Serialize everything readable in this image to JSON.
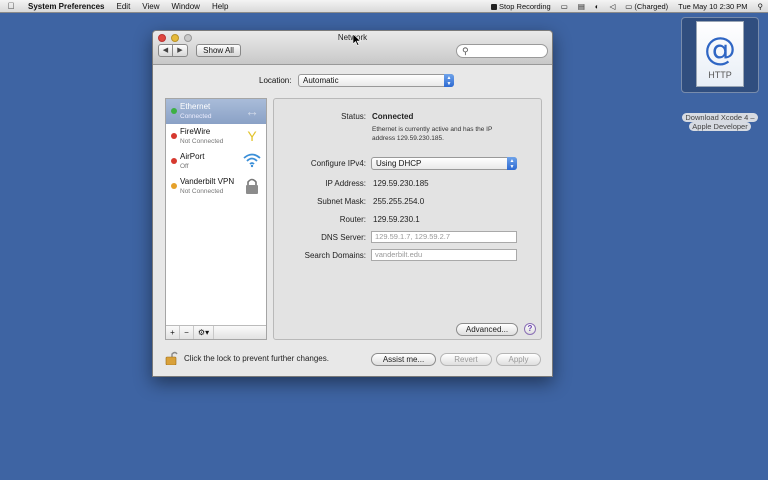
{
  "menubar": {
    "app_name": "System Preferences",
    "items": [
      "Edit",
      "View",
      "Window",
      "Help"
    ],
    "status": {
      "recording": "Stop Recording",
      "battery": "(Charged)",
      "clock": "Tue May 10  2:30 PM"
    }
  },
  "desktop_icon": {
    "glyph": "@",
    "type": "HTTP",
    "label_line1": "Download Xcode 4 –",
    "label_line2": "Apple Developer"
  },
  "window": {
    "title": "Network",
    "show_all": "Show All",
    "nav_back": "◀",
    "nav_forward": "▶",
    "search_placeholder": "",
    "location_label": "Location:",
    "location_value": "Automatic",
    "services": [
      {
        "name": "Ethernet",
        "status": "Connected",
        "dot": "#3cb043"
      },
      {
        "name": "FireWire",
        "status": "Not Connected",
        "dot": "#d6392f"
      },
      {
        "name": "AirPort",
        "status": "Off",
        "dot": "#d6392f"
      },
      {
        "name": "Vanderbilt VPN",
        "status": "Not Connected",
        "dot": "#e6a12a"
      }
    ],
    "list_buttons": {
      "add": "+",
      "remove": "−",
      "gear": "⚙▾"
    },
    "details": {
      "status_label": "Status:",
      "status_value": "Connected",
      "status_desc_line1": "Ethernet is currently active and has the IP",
      "status_desc_line2": "address 129.59.230.185.",
      "configure_label": "Configure IPv4:",
      "configure_value": "Using DHCP",
      "ip_label": "IP Address:",
      "ip_value": "129.59.230.185",
      "subnet_label": "Subnet Mask:",
      "subnet_value": "255.255.254.0",
      "router_label": "Router:",
      "router_value": "129.59.230.1",
      "dns_label": "DNS Server:",
      "dns_value": "129.59.1.7, 129.59.2.7",
      "search_domains_label": "Search Domains:",
      "search_domains_value": "vanderbilt.edu",
      "advanced": "Advanced...",
      "help": "?"
    },
    "lock_text": "Click the lock to prevent further changes.",
    "assist": "Assist me...",
    "revert": "Revert",
    "apply": "Apply"
  }
}
